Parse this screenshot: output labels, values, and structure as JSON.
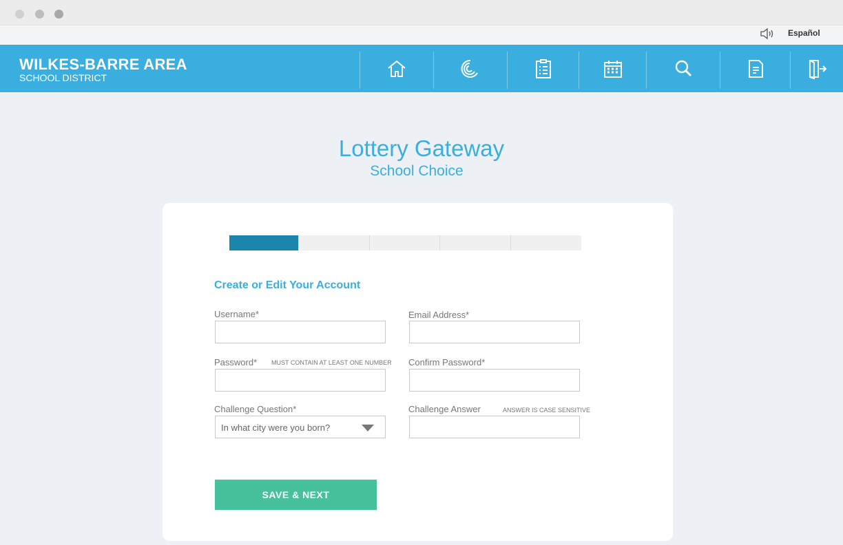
{
  "utility": {
    "language_link": "Español"
  },
  "brand": {
    "title": "WILKES-BARRE AREA",
    "subtitle": "SCHOOL DISTRICT"
  },
  "nav": {
    "icons": [
      "home-icon",
      "loading-icon",
      "clipboard-icon",
      "calendar-icon",
      "search-icon",
      "document-icon",
      "logout-icon"
    ]
  },
  "page": {
    "title": "Lottery Gateway",
    "subtitle": "School Choice"
  },
  "progress": {
    "current_step": 1,
    "total_steps": 5
  },
  "form": {
    "section_title": "Create or Edit Your Account",
    "username": {
      "label": "Username*",
      "value": ""
    },
    "email": {
      "label": "Email Address*",
      "value": ""
    },
    "password": {
      "label": "Password*",
      "hint": "MUST CONTAIN AT LEAST ONE NUMBER",
      "value": ""
    },
    "confirm_password": {
      "label": "Confirm Password*",
      "value": ""
    },
    "challenge_question": {
      "label": "Challenge Question*",
      "selected": "In what city were you born?"
    },
    "challenge_answer": {
      "label": "Challenge Answer",
      "hint": "ANSWER IS CASE SENSITIVE",
      "value": ""
    },
    "submit_label": "SAVE & NEXT"
  },
  "colors": {
    "header": "#3aaede",
    "accent": "#3aaede",
    "progress_active": "#1a85ad",
    "button": "#46c19c",
    "background": "#edf0f5"
  }
}
